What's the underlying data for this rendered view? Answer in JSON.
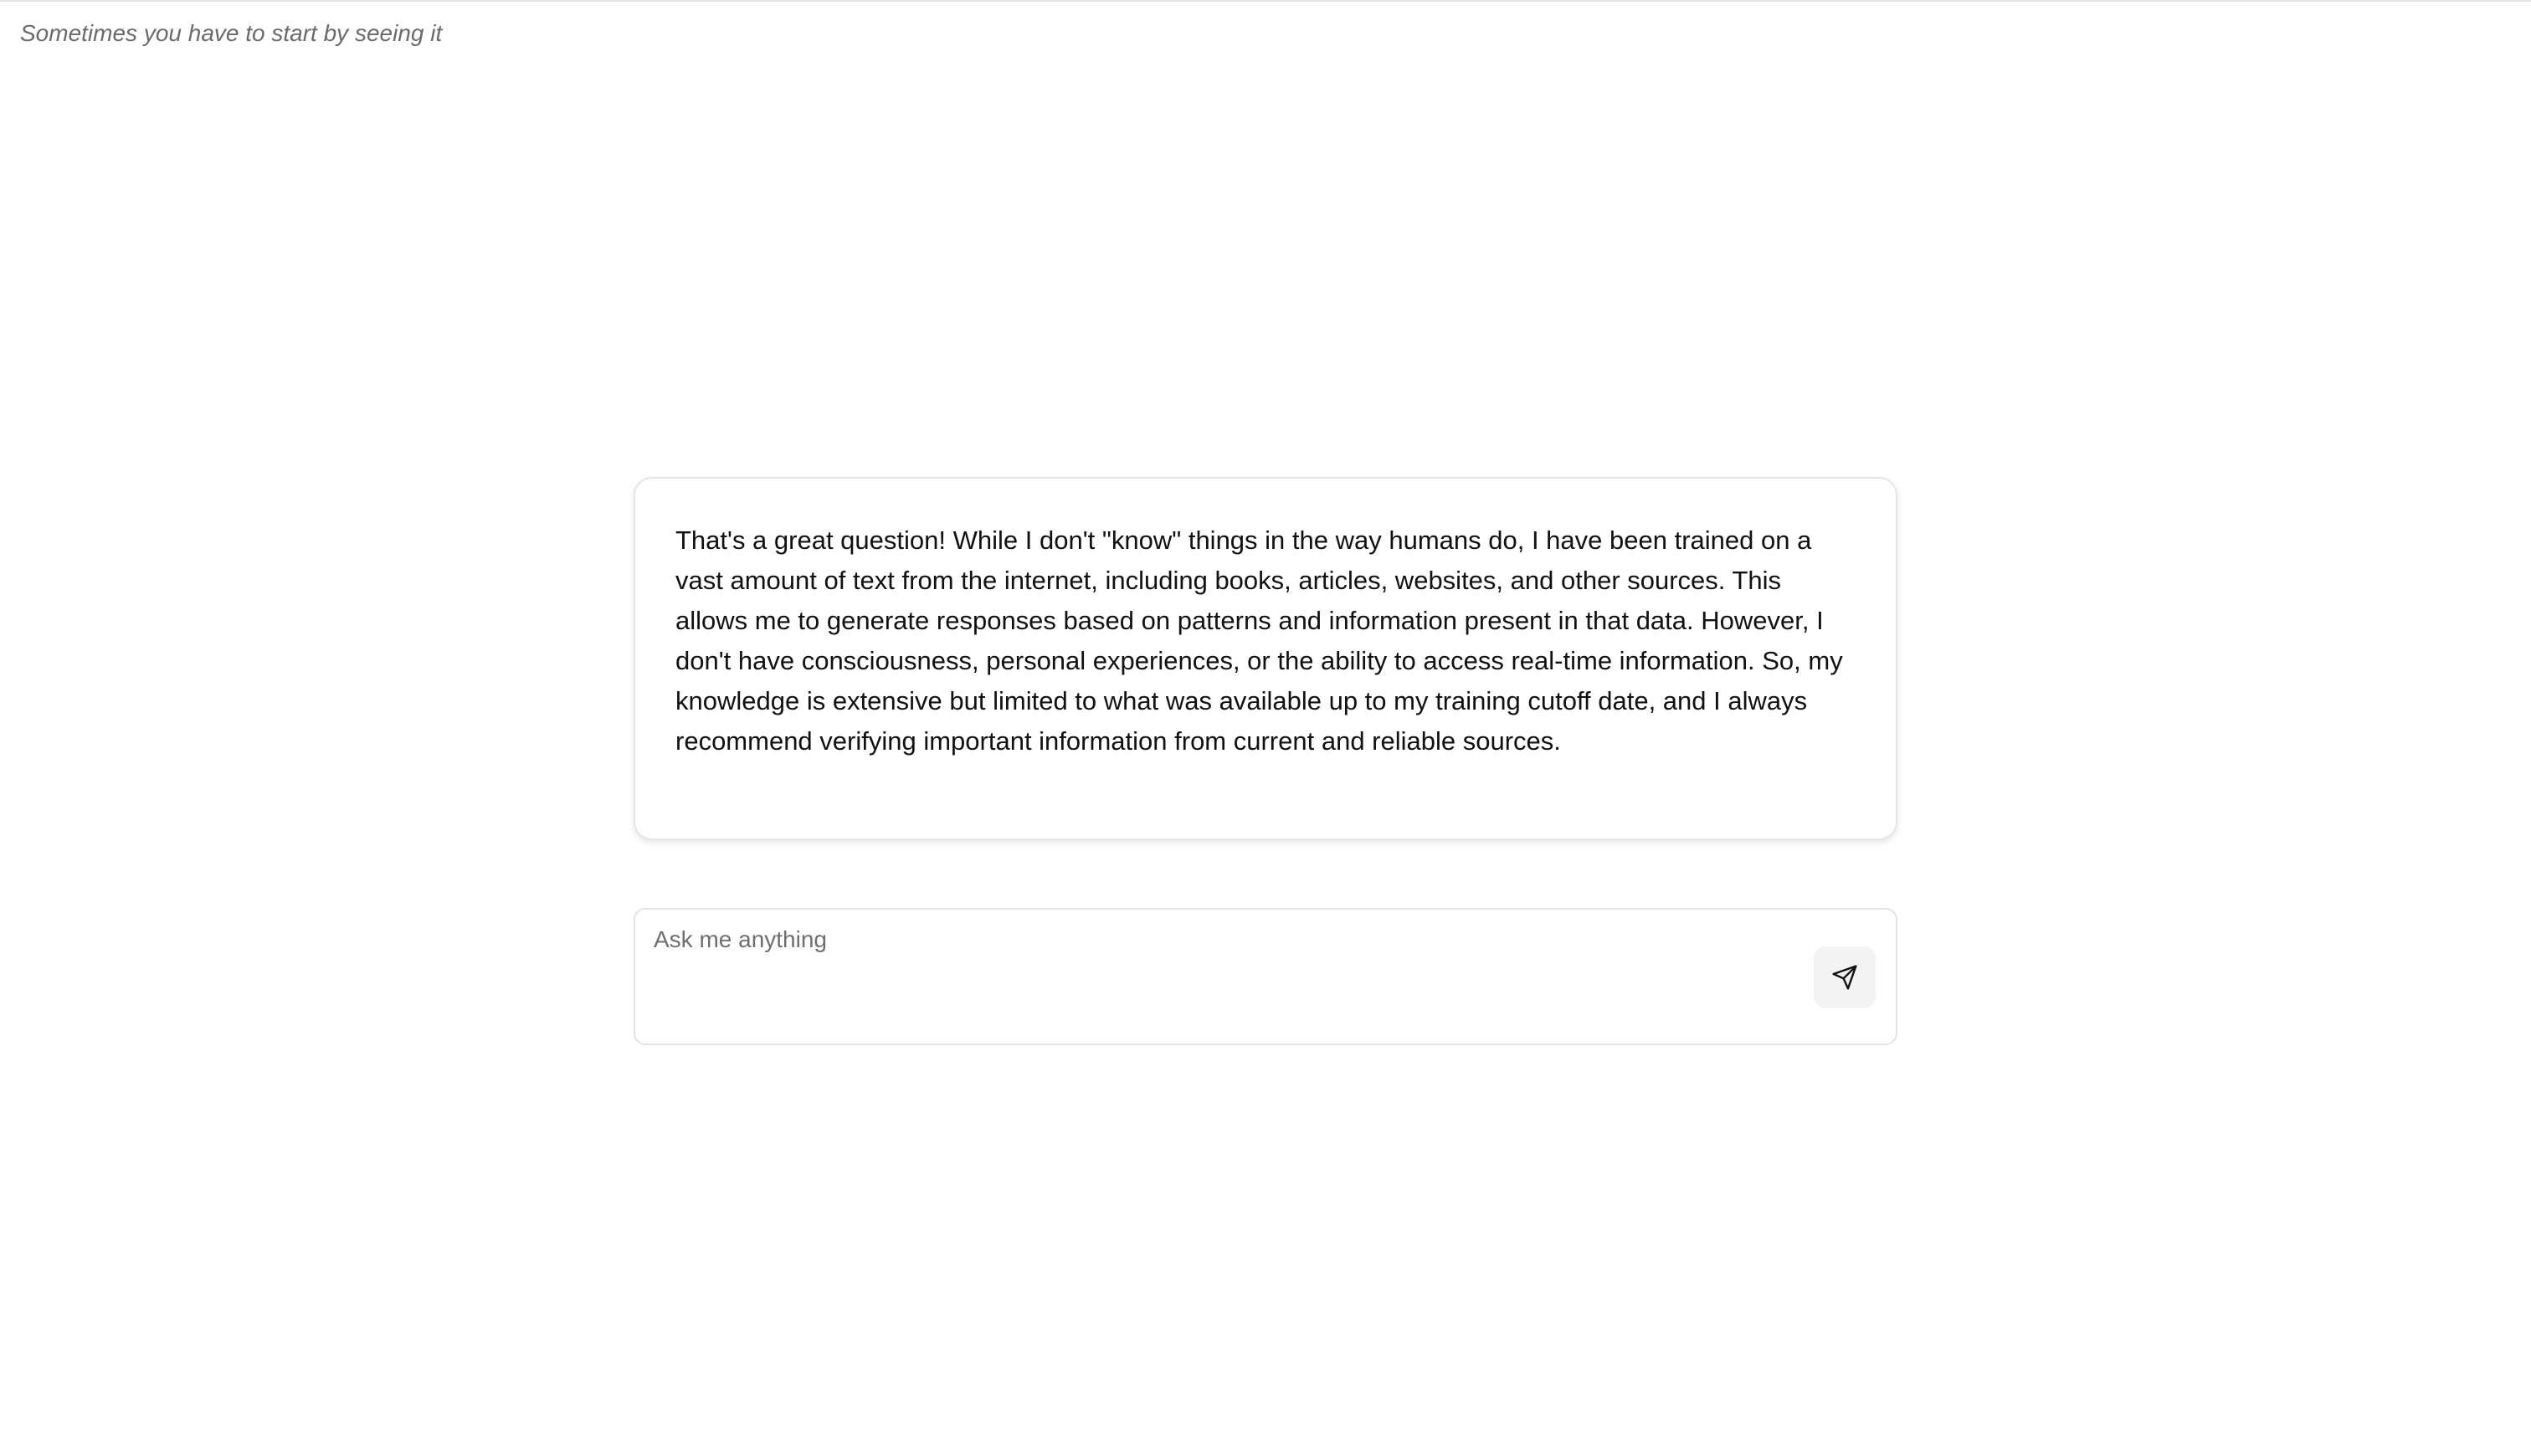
{
  "header": {
    "tagline": "Sometimes you have to start by seeing it"
  },
  "response": {
    "text": "That's a great question! While I don't \"know\" things in the way humans do, I have been trained on a vast amount of text from the internet, including books, articles, websites, and other sources. This allows me to generate responses based on patterns and information present in that data. However, I don't have consciousness, personal experiences, or the ability to access real-time information. So, my knowledge is extensive but limited to what was available up to my training cutoff date, and I always recommend verifying important information from current and reliable sources."
  },
  "composer": {
    "placeholder": "Ask me anything",
    "value": "",
    "send_icon": "send-icon"
  }
}
